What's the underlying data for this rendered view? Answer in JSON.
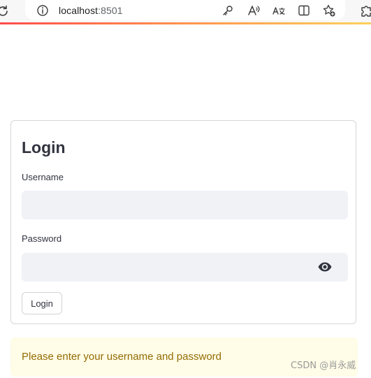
{
  "browser": {
    "url_host": "localhost",
    "url_port": ":8501",
    "icons": [
      "reload-icon",
      "info-icon",
      "key-icon",
      "read-aloud-icon",
      "translate-icon",
      "split-screen-icon",
      "add-favorite-icon",
      "extensions-icon"
    ],
    "accent_gradient": [
      "#ff4b4b",
      "#ff8c4b",
      "#ffd15c"
    ]
  },
  "login_form": {
    "title": "Login",
    "username_label": "Username",
    "username_value": "",
    "password_label": "Password",
    "password_value": "",
    "submit_label": "Login"
  },
  "alert": {
    "type": "warning",
    "message": "Please enter your username and password",
    "background": "#fffce7",
    "text_color": "#926c05"
  },
  "watermark": {
    "text": "CSDN @肖永威"
  }
}
